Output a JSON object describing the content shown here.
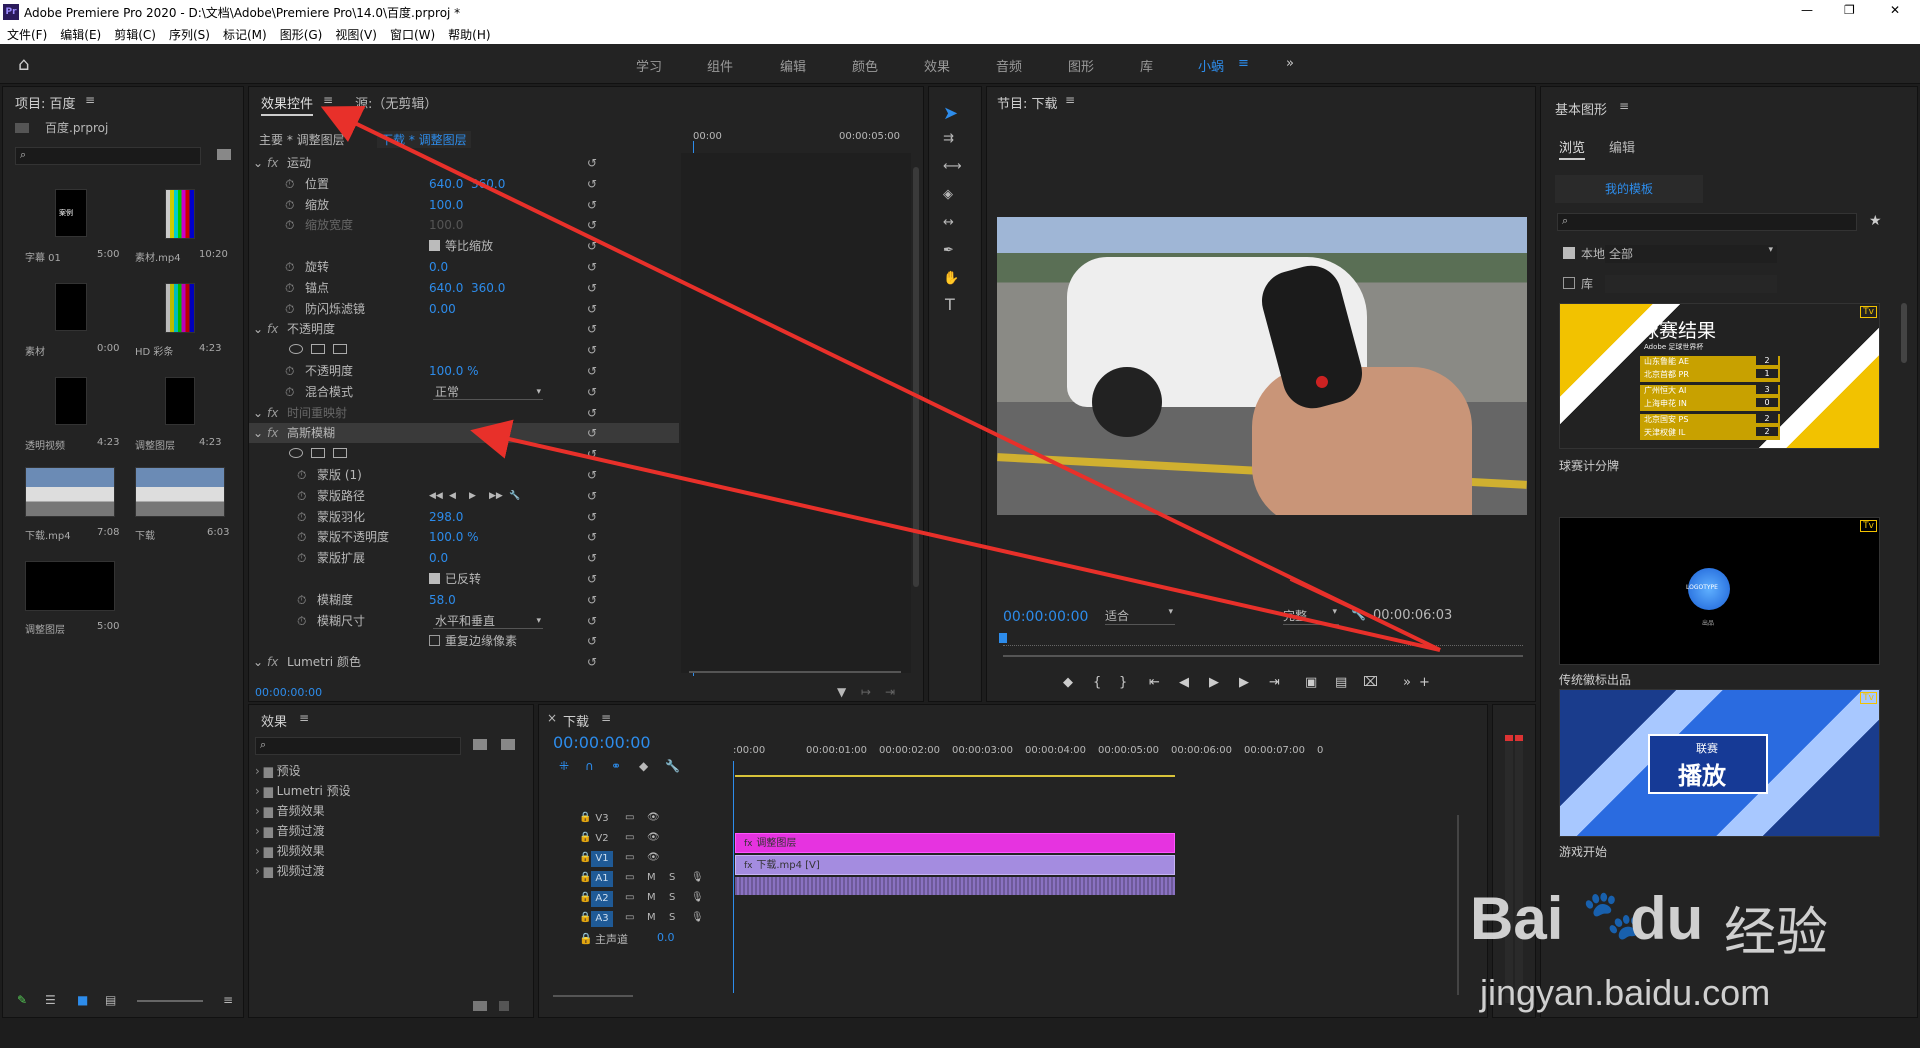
{
  "titlebar": {
    "icon": "Pr",
    "title": "Adobe Premiere Pro 2020 - D:\\文档\\Adobe\\Premiere Pro\\14.0\\百度.prproj *",
    "min": "—",
    "max": "❐",
    "close": "✕"
  },
  "menu": [
    "文件(F)",
    "编辑(E)",
    "剪辑(C)",
    "序列(S)",
    "标记(M)",
    "图形(G)",
    "视图(V)",
    "窗口(W)",
    "帮助(H)"
  ],
  "workspaces": [
    "学习",
    "组件",
    "编辑",
    "颜色",
    "效果",
    "音频",
    "图形",
    "库",
    "小蜗",
    "≡",
    "»"
  ],
  "project": {
    "title": "项目: 百度",
    "menu": "≡",
    "file": "百度.prproj",
    "items": [
      {
        "name": "字幕 01",
        "dur": "5:00",
        "thumb_text": "案例"
      },
      {
        "name": "素材.mp4",
        "dur": "10:20"
      },
      {
        "name": "素材",
        "dur": "0:00"
      },
      {
        "name": "HD 彩条",
        "dur": "4:23"
      },
      {
        "name": "透明视频",
        "dur": "4:23"
      },
      {
        "name": "调整图层",
        "dur": "4:23"
      },
      {
        "name": "下载.mp4",
        "dur": "7:08"
      },
      {
        "name": "下载",
        "dur": "6:03"
      },
      {
        "name": "调整图层",
        "dur": "5:00"
      }
    ]
  },
  "effect_controls": {
    "tab": "效果控件",
    "tab_menu": "≡",
    "source_tab": "源:（无剪辑）",
    "master": "主要 * 调整图层",
    "seq": "下载 * 调整图层",
    "time_start": "00:00",
    "time_end": "00:00:05:00",
    "footer_time": "00:00:00:00",
    "rows": [
      {
        "label": "运动",
        "fx": true
      },
      {
        "label": "位置",
        "v1": "640.0",
        "v2": "360.0"
      },
      {
        "label": "缩放",
        "v1": "100.0"
      },
      {
        "label": "缩放宽度",
        "v1": "100.0",
        "dim": true
      },
      {
        "label": "等比缩放",
        "check": true
      },
      {
        "label": "旋转",
        "v1": "0.0"
      },
      {
        "label": "锚点",
        "v1": "640.0",
        "v2": "360.0"
      },
      {
        "label": "防闪烁滤镜",
        "v1": "0.00"
      },
      {
        "label": "不透明度",
        "fx": true
      },
      {
        "label": "",
        "masks": true
      },
      {
        "label": "不透明度",
        "v1": "100.0 %"
      },
      {
        "label": "混合模式",
        "dropdown": "正常"
      },
      {
        "label": "时间重映射",
        "fx": true,
        "dim": true
      },
      {
        "label": "高斯模糊",
        "fx": true,
        "hl": true
      },
      {
        "label": "",
        "masks": true
      },
      {
        "label": "蒙版 (1)"
      },
      {
        "label": "蒙版路径",
        "controls": true
      },
      {
        "label": "蒙版羽化",
        "v1": "298.0"
      },
      {
        "label": "蒙版不透明度",
        "v1": "100.0 %"
      },
      {
        "label": "蒙版扩展",
        "v1": "0.0"
      },
      {
        "label": "已反转",
        "check": true
      },
      {
        "label": "模糊度",
        "v1": "58.0"
      },
      {
        "label": "模糊尺寸",
        "dropdown": "水平和垂直"
      },
      {
        "label": "重复边缘像素",
        "checkoff": true
      },
      {
        "label": "Lumetri 颜色",
        "fx": true
      }
    ]
  },
  "program": {
    "title": "节目: 下载",
    "menu": "≡",
    "tc": "00:00:00:00",
    "fit": "适合",
    "quality": "完整",
    "duration": "00:00:06:03"
  },
  "effects": {
    "title": "效果",
    "menu": "≡",
    "items": [
      "预设",
      "Lumetri 预设",
      "音频效果",
      "音频过渡",
      "视频效果",
      "视频过渡"
    ]
  },
  "timeline": {
    "title": "下载",
    "menu": "≡",
    "tc": "00:00:00:00",
    "ticks": [
      ":00:00",
      "00:00:01:00",
      "00:00:02:00",
      "00:00:03:00",
      "00:00:04:00",
      "00:00:05:00",
      "00:00:06:00",
      "00:00:07:00",
      "0"
    ],
    "tracks": [
      "V3",
      "V2",
      "V1",
      "A1",
      "A2",
      "A3"
    ],
    "master": "主声道",
    "master_val": "0.0",
    "clip_adj": "调整图层",
    "clip_video": "下载.mp4 [V]"
  },
  "essential_graphics": {
    "title": "基本图形",
    "menu": "≡",
    "tab_browse": "浏览",
    "tab_edit": "编辑",
    "my_templates": "我的模板",
    "local": "本地",
    "local_val": "全部",
    "lib": "库",
    "cards": [
      {
        "name": "球赛计分牌",
        "title": "球赛结果",
        "sub": "Adobe 足球世界杯",
        "rows": [
          [
            "山东鲁能  AE",
            "2"
          ],
          [
            "北京首都  PR",
            "1"
          ],
          [
            "广州恒大  AI",
            "3"
          ],
          [
            "上海申花  IN",
            "0"
          ],
          [
            "北京国安  PS",
            "2"
          ],
          [
            "天津权健  IL",
            "2"
          ]
        ]
      },
      {
        "name": "传统徽标出品",
        "logo": "LOGOTYPE",
        "sub": "出品"
      },
      {
        "name": "游戏开始",
        "top": "联赛",
        "big": "播放"
      }
    ]
  },
  "watermark": {
    "brand": "Bai",
    "du": "du",
    "cn": "经验",
    "url": "jingyan.baidu.com"
  }
}
